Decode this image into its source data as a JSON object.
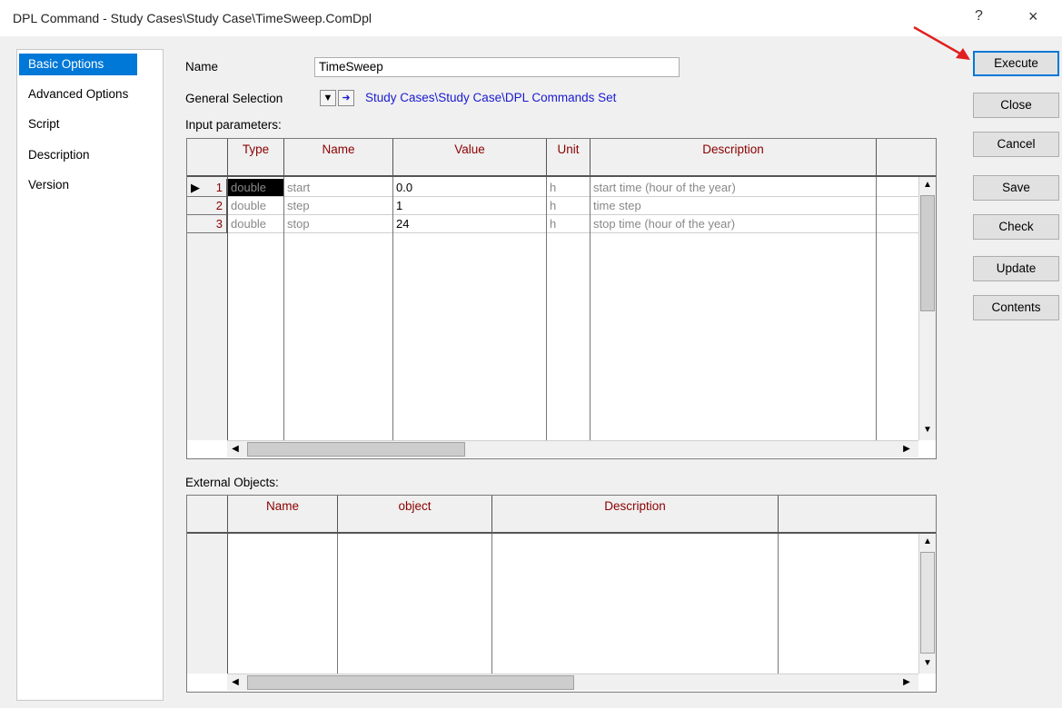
{
  "window": {
    "title": "DPL Command - Study Cases\\Study Case\\TimeSweep.ComDpl",
    "help": "?",
    "close": "×"
  },
  "sidebar": {
    "items": [
      {
        "label": "Basic Options",
        "selected": true
      },
      {
        "label": "Advanced Options"
      },
      {
        "label": "Script"
      },
      {
        "label": "Description"
      },
      {
        "label": "Version"
      }
    ]
  },
  "form": {
    "name_label": "Name",
    "name_value": "TimeSweep",
    "general_selection_label": "General Selection",
    "general_selection_path": "Study Cases\\Study Case\\DPL Commands Set",
    "input_params_label": "Input parameters:",
    "external_objects_label": "External Objects:"
  },
  "input_table": {
    "columns": [
      "Type",
      "Name",
      "Value",
      "Unit",
      "Description"
    ],
    "rows": [
      {
        "num": "1",
        "type": "double",
        "name": "start",
        "value": "0.0",
        "unit": "h",
        "description": "start time (hour of the year)",
        "current": true
      },
      {
        "num": "2",
        "type": "double",
        "name": "step",
        "value": "1",
        "unit": "h",
        "description": "time step"
      },
      {
        "num": "3",
        "type": "double",
        "name": "stop",
        "value": "24",
        "unit": "h",
        "description": "stop time (hour of the year)"
      }
    ]
  },
  "external_table": {
    "columns": [
      "Name",
      "object",
      "Description"
    ]
  },
  "buttons": [
    "Execute",
    "Close",
    "Cancel",
    "Save",
    "Check",
    "Update",
    "Contents"
  ],
  "colors": {
    "selection": "#0078d7",
    "header_text": "#8b0000",
    "link": "#1a1ad0",
    "arrow": "#e02020"
  }
}
